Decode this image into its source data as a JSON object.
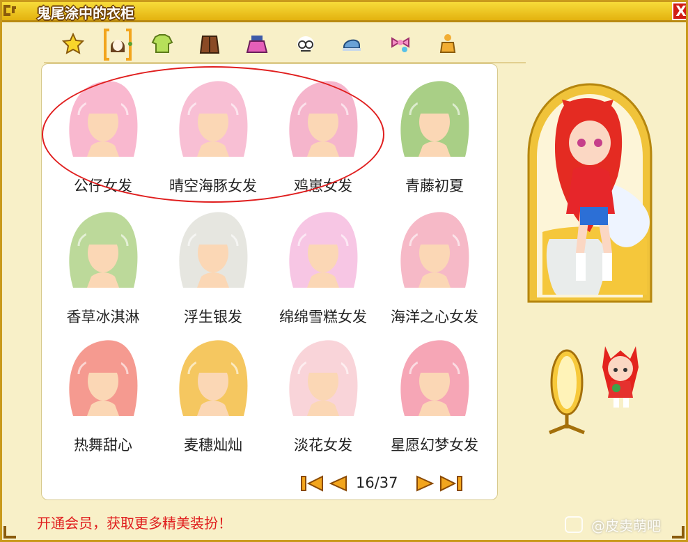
{
  "window": {
    "title": "鬼尾涂中的衣柜",
    "close_label": "X"
  },
  "tabs": [
    {
      "id": "favorites",
      "icon": "star-icon"
    },
    {
      "id": "hair",
      "icon": "hair-icon",
      "selected": true
    },
    {
      "id": "top",
      "icon": "shirt-icon"
    },
    {
      "id": "coat",
      "icon": "jacket-icon"
    },
    {
      "id": "bottom",
      "icon": "skirt-icon"
    },
    {
      "id": "face",
      "icon": "face-icon"
    },
    {
      "id": "hat",
      "icon": "hat-icon"
    },
    {
      "id": "accessory",
      "icon": "bow-icon"
    },
    {
      "id": "suit",
      "icon": "suit-icon"
    }
  ],
  "items": [
    {
      "label": "公仔女发",
      "color": "#f9b8cf"
    },
    {
      "label": "晴空海豚女发",
      "color": "#f8bfd4"
    },
    {
      "label": "鸡崽女发",
      "color": "#f5b5cc"
    },
    {
      "label": "青藤初夏",
      "color": "#a9cf86"
    },
    {
      "label": "香草冰淇淋",
      "color": "#bcd99a"
    },
    {
      "label": "浮生银发",
      "color": "#e6e6e0"
    },
    {
      "label": "绵绵雪糕女发",
      "color": "#f7c6e4"
    },
    {
      "label": "海洋之心女发",
      "color": "#f6b9c7"
    },
    {
      "label": "热舞甜心",
      "color": "#f59a90"
    },
    {
      "label": "麦穗灿灿",
      "color": "#f5c760"
    },
    {
      "label": "淡花女发",
      "color": "#f9d4d9"
    },
    {
      "label": "星愿幻梦女发",
      "color": "#f6a6b6"
    }
  ],
  "pager": {
    "current": 16,
    "total": 37,
    "text": "16/37"
  },
  "promo": "开通会员，获取更多精美装扮！",
  "watermark": "@皮卖萌吧"
}
